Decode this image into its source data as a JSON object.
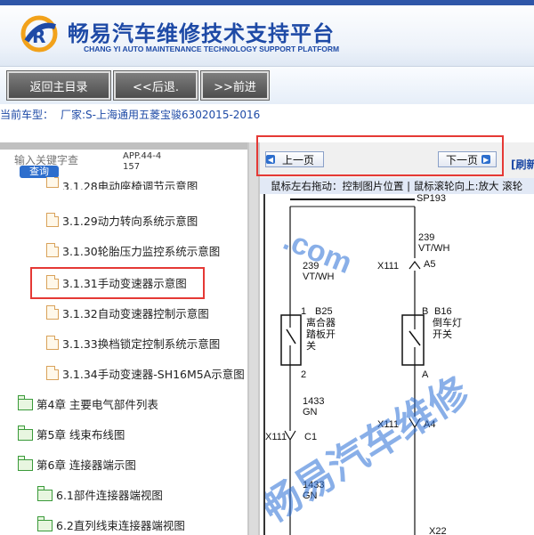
{
  "header": {
    "title": "畅易汽车维修技术支持平台",
    "subtitle": "CHANG YI AUTO MAINTENANCE TECHNOLOGY SUPPORT PLATFORM",
    "logo_icon": "ry-logo-icon"
  },
  "nav": {
    "home": "返回主目录",
    "back": "<<后退.",
    "forward": ">>前进"
  },
  "car_info": {
    "label": "当前车型：",
    "maker": "厂家:S-上海通用五菱宝骏6302015-2016"
  },
  "search": {
    "placeholder": "输入关键字查",
    "button": "查询",
    "app_code": "APP.44-4157"
  },
  "tree": {
    "partial_top": "3.1.28电动座椅调节示意图",
    "items": [
      "3.1.29动力转向系统示意图",
      "3.1.30轮胎压力监控系统示意图",
      "3.1.31手动变速器示意图",
      "3.1.32自动变速器控制示意图",
      "3.1.33换档锁定控制系统示意图",
      "3.1.34手动变速器-SH16M5A示意图"
    ],
    "chapters": [
      "第4章 主要电气部件列表",
      "第5章 线束布线图",
      "第6章 连接器端示图"
    ],
    "sub": [
      "6.1部件连接器端视图",
      "6.2直列线束连接器端视图"
    ]
  },
  "pager": {
    "prev": "上一页",
    "next": "下一页",
    "refresh": "[刷新"
  },
  "hint": "鼠标左右拖动：控制图片位置 | 鼠标滚轮向上:放大  滚轮",
  "diagram": {
    "top_label": "SP193",
    "left_wire": {
      "num": "239",
      "color": "VT/WH"
    },
    "right_wire": {
      "num": "239",
      "color": "VT/WH"
    },
    "right_conn": {
      "name": "X111",
      "pin": "A5"
    },
    "left_switch": {
      "pin_top": "1",
      "name": "B25",
      "desc1": "离合器",
      "desc2": "踏板开",
      "desc3": "关",
      "pin_bottom": "2"
    },
    "right_switch": {
      "pin_top": "B",
      "name": "B16",
      "desc1": "倒车灯",
      "desc2": "开关",
      "pin_bottom": "A"
    },
    "left_wire2": {
      "num": "1433",
      "color": "GN"
    },
    "left_conn": {
      "name": "X111",
      "pin": "C1"
    },
    "right_conn2": {
      "name": "X111",
      "pin": "A4"
    },
    "left_wire3": {
      "num": "1433",
      "color": "GN"
    },
    "bottom_partial": "X22"
  },
  "colors": {
    "brand": "#1e4aa6",
    "highlight": "#e53935",
    "watermark": "#2a6fd6"
  }
}
